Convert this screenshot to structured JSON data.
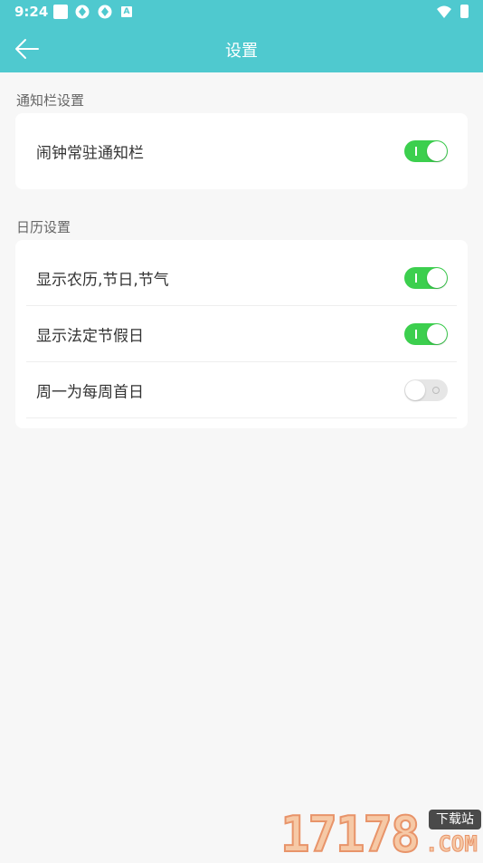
{
  "status_bar": {
    "time": "9:24",
    "badge_letter": "A"
  },
  "header": {
    "title": "设置",
    "background": "#4fc9cf"
  },
  "sections": [
    {
      "label": "通知栏设置",
      "items": [
        {
          "label": "闹钟常驻通知栏",
          "enabled": true
        }
      ]
    },
    {
      "label": "日历设置",
      "items": [
        {
          "label": "显示农历,节日,节气",
          "enabled": true
        },
        {
          "label": "显示法定节假日",
          "enabled": true
        },
        {
          "label": "周一为每周首日",
          "enabled": false
        }
      ]
    }
  ],
  "colors": {
    "toggle_on": "#3ccf4e",
    "toggle_off": "#e6e6e6"
  },
  "watermark": {
    "number": "17178",
    "badge": "下载站",
    "suffix": ".COM"
  }
}
